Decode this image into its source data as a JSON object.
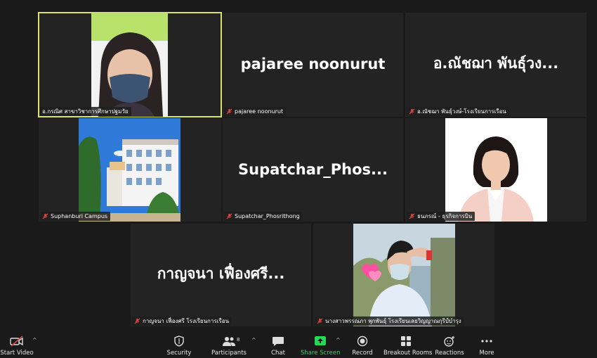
{
  "tiles": [
    {
      "name_label": "อ.กรณิศ สาขาวิชาการศึกษาปฐมวัย",
      "kind": "video-person-mask"
    },
    {
      "big_name": "pajaree noonurut",
      "name_label": "pajaree noonurut"
    },
    {
      "big_name": "อ.ณัชฌา พันธุ์วง...",
      "name_label": "อ.ณัชฌา พันธุ์วงษ์-โรงเรียนการเรือน"
    },
    {
      "name_label": "Suphanburi Campus",
      "kind": "video-building"
    },
    {
      "big_name": "Supatchar_Phos...",
      "name_label": "Supatchar_Phosrithong"
    },
    {
      "name_label": "ธนภรณ์ - ธุรกิจการบิน",
      "kind": "video-portrait"
    },
    {
      "big_name": "กาญจนา เฟื่องศรี...",
      "name_label": "กาญจนา เฟื่องศรี โรงเรียนการเรือน"
    },
    {
      "name_label": "นางสาวพรรณภา พุกพันธุ์ โรงเรียนเลยวิญญาณกุรีป์บำรุง",
      "kind": "video-student"
    }
  ],
  "toolbar": {
    "start_video": "Start Video",
    "security": "Security",
    "participants": "Participants",
    "participants_count": "8",
    "chat": "Chat",
    "share_screen": "Share Screen",
    "record": "Record",
    "breakout_rooms": "Breakout Rooms",
    "reactions": "Reactions",
    "more": "More"
  },
  "colors": {
    "active_speaker": "#d8e36a",
    "muted_mic": "#e0463c",
    "share_green": "#23d959"
  }
}
